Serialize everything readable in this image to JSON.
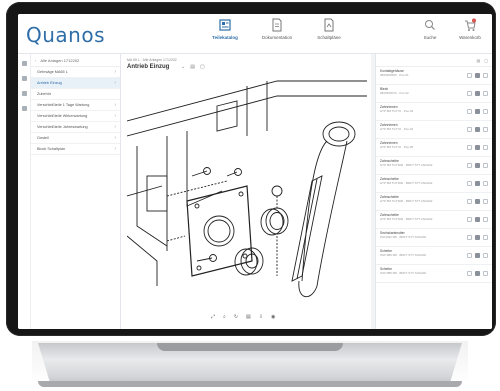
{
  "app": {
    "logo": "Quanos"
  },
  "nav": {
    "items": [
      {
        "label": "Teilekatalog",
        "icon": "catalog-icon",
        "active": true
      },
      {
        "label": "Dokumentation",
        "icon": "document-icon",
        "active": false
      },
      {
        "label": "Schaltpläne",
        "icon": "schematic-icon",
        "active": false
      }
    ],
    "right": [
      {
        "label": "Suche",
        "icon": "search-icon"
      },
      {
        "label": "Warenkorb",
        "icon": "cart-icon"
      }
    ]
  },
  "sidebar": {
    "header": "Alle Anlagen 1712202",
    "items": [
      {
        "label": "Gehrsäge MA65 L"
      },
      {
        "label": "Antrieb Einzug",
        "active": true
      },
      {
        "label": "Zubehör"
      },
      {
        "label": "Verschleißteile 1 Tage Wartung"
      },
      {
        "label": "Verschleißteile Wirkerwartung"
      },
      {
        "label": "Verschleißteile Jahreswartung"
      },
      {
        "label": "Gestell"
      },
      {
        "label": "Block Schaltplan"
      }
    ]
  },
  "main": {
    "breadcrumb": "MA 65 L  ·  Alle Anlagen 1712202",
    "title": "Antrieb Einzug"
  },
  "parts": [
    {
      "name": "Kontaktgehäuse",
      "meta": "0820306560 · Pos 01"
    },
    {
      "name": "Blech",
      "meta": "0820306070 · Pos 02"
    },
    {
      "name": "Zahnriemen",
      "meta": "HTP 8M TGT70 · Pos 03"
    },
    {
      "name": "Zahnriemen",
      "meta": "HTP 8M TGT70 · Pos 04"
    },
    {
      "name": "Zahnriemen",
      "meta": "HTP 8M TGT70 · Pos 05"
    },
    {
      "name": "Zahnscheibe",
      "meta": "HTP 8M TGTR40 · BRKT STT ANG002"
    },
    {
      "name": "Zahnscheibe",
      "meta": "HTP 8M TGTR40 · BRKT STT ANG002"
    },
    {
      "name": "Zahnscheibe",
      "meta": "HTP 8M TGTR40 · BRKT STT ANG002"
    },
    {
      "name": "Zahnscheibe",
      "meta": "HTP 8M TGTR40 · BRKT STT ANG002"
    },
    {
      "name": "Sechskantmutter",
      "meta": "ISO4032 M8 · BRKT STT ANG002"
    },
    {
      "name": "Scheibe",
      "meta": "ISO7089 M8 · BRKT STT ANG002"
    },
    {
      "name": "Scheibe",
      "meta": "ISO7089 M8 · BRKT STT ANG002"
    }
  ],
  "colors": {
    "brand": "#2f6ea8",
    "active_bg": "#e8f0f8"
  }
}
